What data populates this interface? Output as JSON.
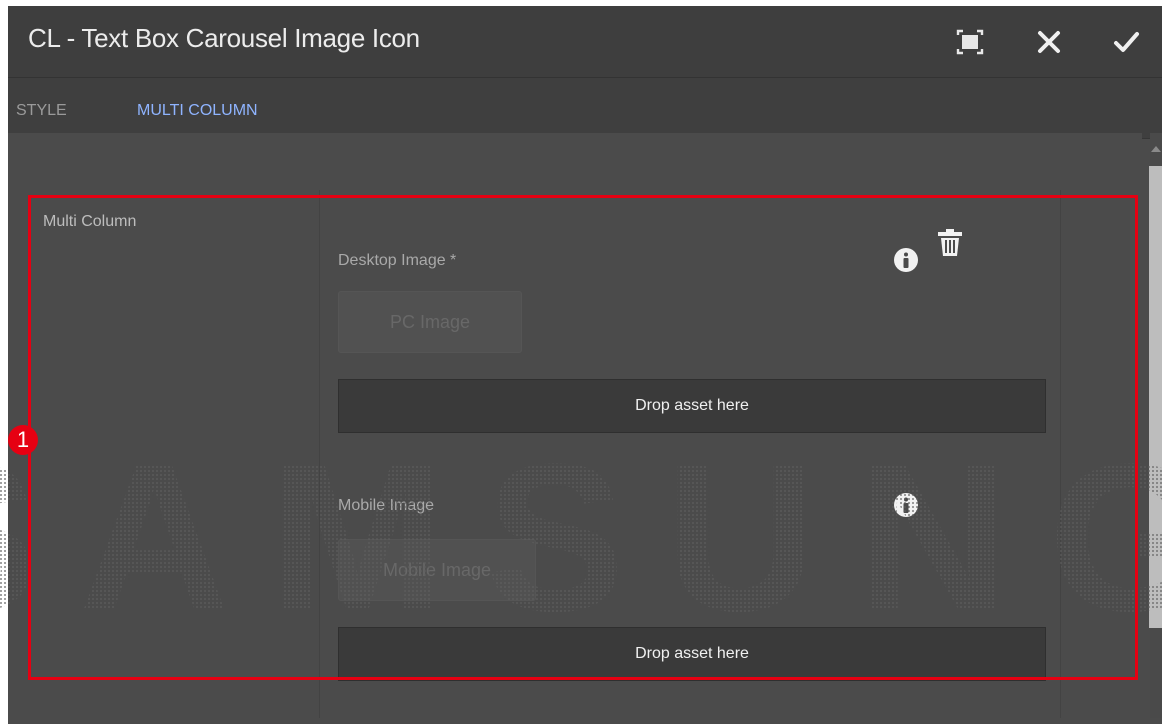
{
  "dialog": {
    "title": "CL - Text Box Carousel Image Icon",
    "actions": {
      "fullscreen_icon": "fullscreen-icon",
      "close_icon": "close-icon",
      "done_icon": "checkmark-icon"
    }
  },
  "tabs": [
    {
      "label": "STYLE",
      "active": false
    },
    {
      "label": "MULTI COLUMN",
      "active": true
    }
  ],
  "multifield": {
    "section_label": "Multi Column",
    "desktop": {
      "label": "Desktop Image *",
      "button_label": "PC Image",
      "drop_label": "Drop asset here"
    },
    "mobile": {
      "label": "Mobile Image",
      "button_label": "Mobile Image",
      "drop_label": "Drop asset here"
    }
  },
  "annotation": {
    "badge": "1",
    "color": "#e60012"
  },
  "watermark": "SAMSUNG",
  "colors": {
    "dialog_bg": "#4b4b4b",
    "titlebar_bg": "#3e3e3e",
    "active_tab": "#8fb4ff",
    "tab_underline": "#6f9fe3"
  }
}
